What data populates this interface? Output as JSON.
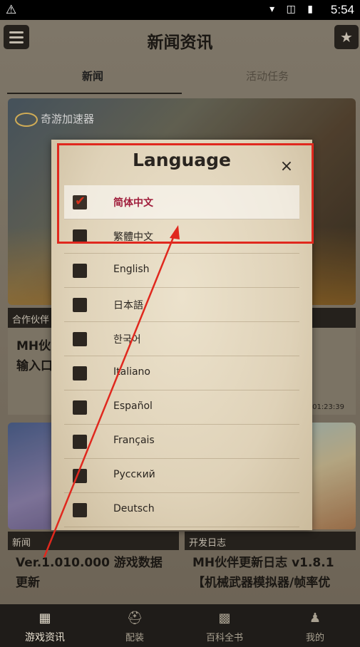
{
  "status": {
    "time": "5:54",
    "warn": "⚠",
    "icons": "▾ ◫ ▮"
  },
  "header": {
    "title": "新闻资讯",
    "menu_icon": "hamburger-icon",
    "star_icon": "star-icon"
  },
  "tabs": [
    {
      "label": "新闻"
    },
    {
      "label": "活动任务"
    }
  ],
  "banner": {
    "logo_text": "奇游加速器"
  },
  "partner_card": {
    "tag": "合作伙伴",
    "text_line1": "MH伙",
    "text_line2": "输入口",
    "timestamp": "0 01:23:39"
  },
  "news_cards": [
    {
      "tag": "新闻",
      "title_line1": "Ver.1.010.000 游戏数据",
      "title_line2": "更新"
    },
    {
      "tag": "开发日志",
      "title_line1": "MH伙伴更新日志 v1.8.1",
      "title_line2": "【机械武器模拟器/帧率优"
    }
  ],
  "dialog": {
    "title": "Language",
    "close": "×",
    "languages": [
      {
        "label": "简体中文",
        "selected": true
      },
      {
        "label": "繁體中文",
        "selected": false
      },
      {
        "label": "English",
        "selected": false
      },
      {
        "label": "日本語",
        "selected": false
      },
      {
        "label": "한국어",
        "selected": false
      },
      {
        "label": "Italiano",
        "selected": false
      },
      {
        "label": "Español",
        "selected": false
      },
      {
        "label": "Français",
        "selected": false
      },
      {
        "label": "Русский",
        "selected": false
      },
      {
        "label": "Deutsch",
        "selected": false
      }
    ]
  },
  "bottom_nav": [
    {
      "label": "游戏资讯",
      "icon": "news-icon",
      "glyph": "▦",
      "active": true
    },
    {
      "label": "配装",
      "icon": "helmet-icon",
      "glyph": "⛑",
      "active": false
    },
    {
      "label": "百科全书",
      "icon": "encyclopedia-icon",
      "glyph": "▩",
      "active": false
    },
    {
      "label": "我的",
      "icon": "profile-icon",
      "glyph": "♟",
      "active": false
    }
  ],
  "annotation": {
    "highlight_color": "#e0281e"
  }
}
